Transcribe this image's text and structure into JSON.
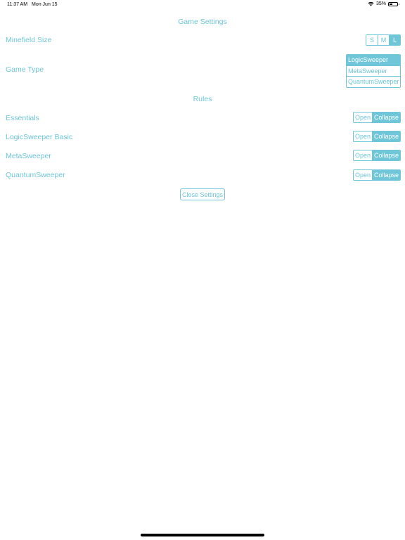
{
  "status_bar": {
    "time": "11:37 AM",
    "date": "Mon Jun 15",
    "battery": "35%",
    "battery_level": 0.35
  },
  "settings": {
    "title": "Game Settings",
    "minefield": {
      "label": "Minefield Size",
      "options": [
        "S",
        "M",
        "L"
      ],
      "selected": "L"
    },
    "game_type": {
      "label": "Game Type",
      "options": [
        "LogicSweeper",
        "MetaSweeper",
        "QuantumSweeper"
      ],
      "selected": "LogicSweeper"
    }
  },
  "rules": {
    "title": "Rules",
    "open_label": "Open",
    "collapse_label": "Collapse",
    "items": [
      {
        "label": "Essentials",
        "selected": "Collapse"
      },
      {
        "label": "LogicSweeper Basic",
        "selected": "Collapse"
      },
      {
        "label": "MetaSweeper",
        "selected": "Collapse"
      },
      {
        "label": "QuantumSweeper",
        "selected": "Collapse"
      }
    ]
  },
  "close_button": "Close Settings",
  "colors": {
    "accent": "#6ec6d8",
    "background": "#ffffff"
  }
}
